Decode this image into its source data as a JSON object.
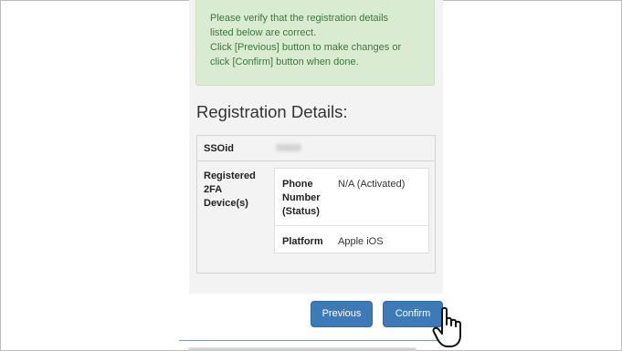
{
  "alert": {
    "lines": [
      "Please verify that the registration details",
      "listed below are correct.",
      "Click [Previous] button to make changes or",
      "click [Confirm] button when done."
    ]
  },
  "heading": "Registration Details:",
  "table": {
    "ssoid_label": "SSOid",
    "ssoid_value": "zivchan",
    "device_label_lines": [
      "Registered",
      "2FA",
      "Device(s)"
    ],
    "device": {
      "phone_label_lines": [
        "Phone",
        "Number",
        "(Status)"
      ],
      "phone_value": "N/A (Activated)",
      "platform_label": "Platform",
      "platform_value": "Apple iOS"
    }
  },
  "buttons": {
    "previous": "Previous",
    "confirm": "Confirm"
  },
  "icons": {
    "cursor": "hand-pointer-icon"
  },
  "colors": {
    "alert_bg": "#d9ecd2",
    "alert_text": "#3c763d",
    "button_bg": "#3d7ab8"
  }
}
